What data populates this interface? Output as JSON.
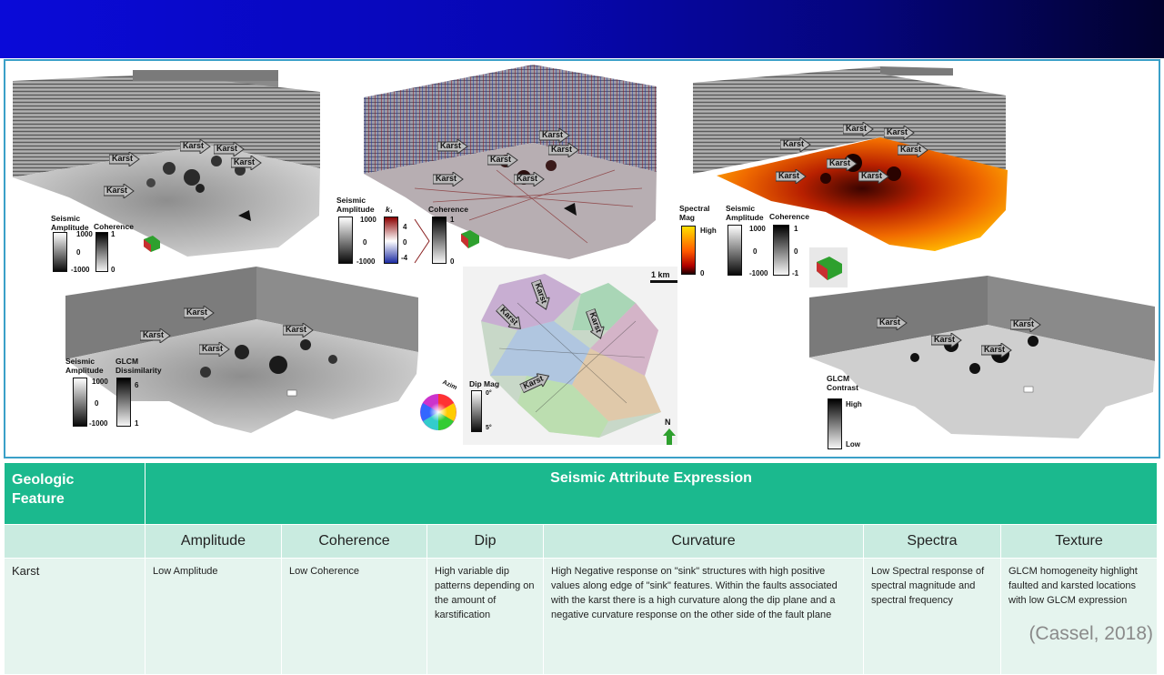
{
  "slide": {
    "header_color": "#0707b4",
    "accent_color": "#1bb98e",
    "citation": "(Cassel, 2018)"
  },
  "figure": {
    "karst_label": "Karst",
    "panel_a": {
      "amp_title": "Seismic\nAmplitude",
      "amp_top": "1000",
      "amp_mid": "0",
      "amp_bot": "-1000",
      "coh_title": "Coherence",
      "coh_top": "1",
      "coh_bot": "0"
    },
    "panel_b": {
      "amp_title": "Seismic\nAmplitude",
      "amp_top": "1000",
      "amp_mid": "0",
      "amp_bot": "-1000",
      "k1_title": "k₁",
      "k1_top": "4",
      "k1_mid": "0",
      "k1_bot": "-4",
      "coh_title": "Coherence",
      "coh_top": "1",
      "coh_bot": "0"
    },
    "panel_c": {
      "spec_title": "Spectral\nMag",
      "spec_top": "High",
      "spec_bot": "0",
      "amp_title": "Seismic\nAmplitude",
      "amp_top": "1000",
      "amp_mid": "0",
      "amp_bot": "-1000",
      "coh_title": "Coherence",
      "coh_top": "1",
      "coh_mid": "0",
      "coh_bot": "-1"
    },
    "panel_d": {
      "amp_title": "Seismic\nAmplitude",
      "amp_top": "1000",
      "amp_mid": "0",
      "amp_bot": "-1000",
      "glcm_title": "GLCM\nDissimilarity",
      "glcm_top": "6",
      "glcm_bot": "1"
    },
    "panel_e": {
      "scale_label": "1 km",
      "azim_label": "Azim",
      "dipmag_title": "Dip Mag",
      "dipmag_top": "0°",
      "dipmag_bot": "5°",
      "north_label": "N"
    },
    "panel_f": {
      "glcm_title": "GLCM\nContrast",
      "glcm_top": "High",
      "glcm_bot": "Low"
    }
  },
  "table": {
    "feature_header": "Geologic\nFeature",
    "expression_header": "Seismic Attribute Expression",
    "columns": [
      "Amplitude",
      "Coherence",
      "Dip",
      "Curvature",
      "Spectra",
      "Texture"
    ],
    "rows": [
      {
        "feature": "Karst",
        "cells": [
          "Low Amplitude",
          "Low Coherence",
          "High variable dip patterns depending on the amount of karstification",
          "High Negative response on \"sink\" structures with high positive values along edge of \"sink\" features.  Within the faults associated with the karst there is a high curvature along the dip plane and a negative curvature response on the other side of the fault plane",
          "Low Spectral response of spectral magnitude and spectral frequency",
          "GLCM homogeneity highlight faulted and karsted locations with low GLCM expression"
        ]
      }
    ]
  }
}
